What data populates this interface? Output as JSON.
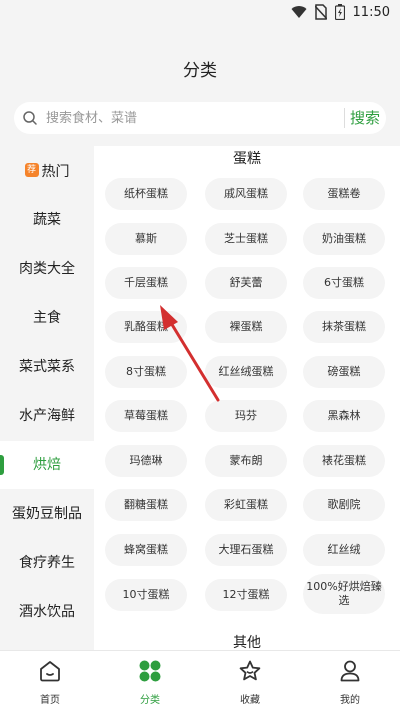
{
  "status": {
    "time": "11:50"
  },
  "page": {
    "title": "分类"
  },
  "search": {
    "placeholder": "搜索食材、菜谱",
    "button_label": "搜索"
  },
  "sidebar": {
    "hot_badge": "荐",
    "items": [
      {
        "label": "热门"
      },
      {
        "label": "蔬菜"
      },
      {
        "label": "肉类大全"
      },
      {
        "label": "主食"
      },
      {
        "label": "菜式菜系"
      },
      {
        "label": "水产海鲜"
      },
      {
        "label": "烘焙"
      },
      {
        "label": "蛋奶豆制品"
      },
      {
        "label": "食疗养生"
      },
      {
        "label": "酒水饮品"
      }
    ],
    "active_index": 6
  },
  "content": {
    "sections": [
      {
        "title": "蛋糕",
        "chips": [
          "纸杯蛋糕",
          "戚风蛋糕",
          "蛋糕卷",
          "慕斯",
          "芝士蛋糕",
          "奶油蛋糕",
          "千层蛋糕",
          "舒芙蕾",
          "6寸蛋糕",
          "乳酪蛋糕",
          "裸蛋糕",
          "抹茶蛋糕",
          "8寸蛋糕",
          "红丝绒蛋糕",
          "磅蛋糕",
          "草莓蛋糕",
          "玛芬",
          "黑森林",
          "玛德琳",
          "蒙布朗",
          "裱花蛋糕",
          "翻糖蛋糕",
          "彩虹蛋糕",
          "歌剧院",
          "蜂窝蛋糕",
          "大理石蛋糕",
          "红丝绒",
          "10寸蛋糕",
          "12寸蛋糕",
          "100%好烘焙臻选"
        ]
      },
      {
        "title": "其他",
        "chips": []
      }
    ]
  },
  "tabbar": {
    "tabs": [
      {
        "label": "首页",
        "icon": "home-icon"
      },
      {
        "label": "分类",
        "icon": "category-icon"
      },
      {
        "label": "收藏",
        "icon": "star-icon"
      },
      {
        "label": "我的",
        "icon": "user-icon"
      }
    ],
    "active_index": 1
  },
  "colors": {
    "accent": "#2e9e3f",
    "badge": "#f5832a",
    "annotation_arrow": "#d32f2f"
  }
}
